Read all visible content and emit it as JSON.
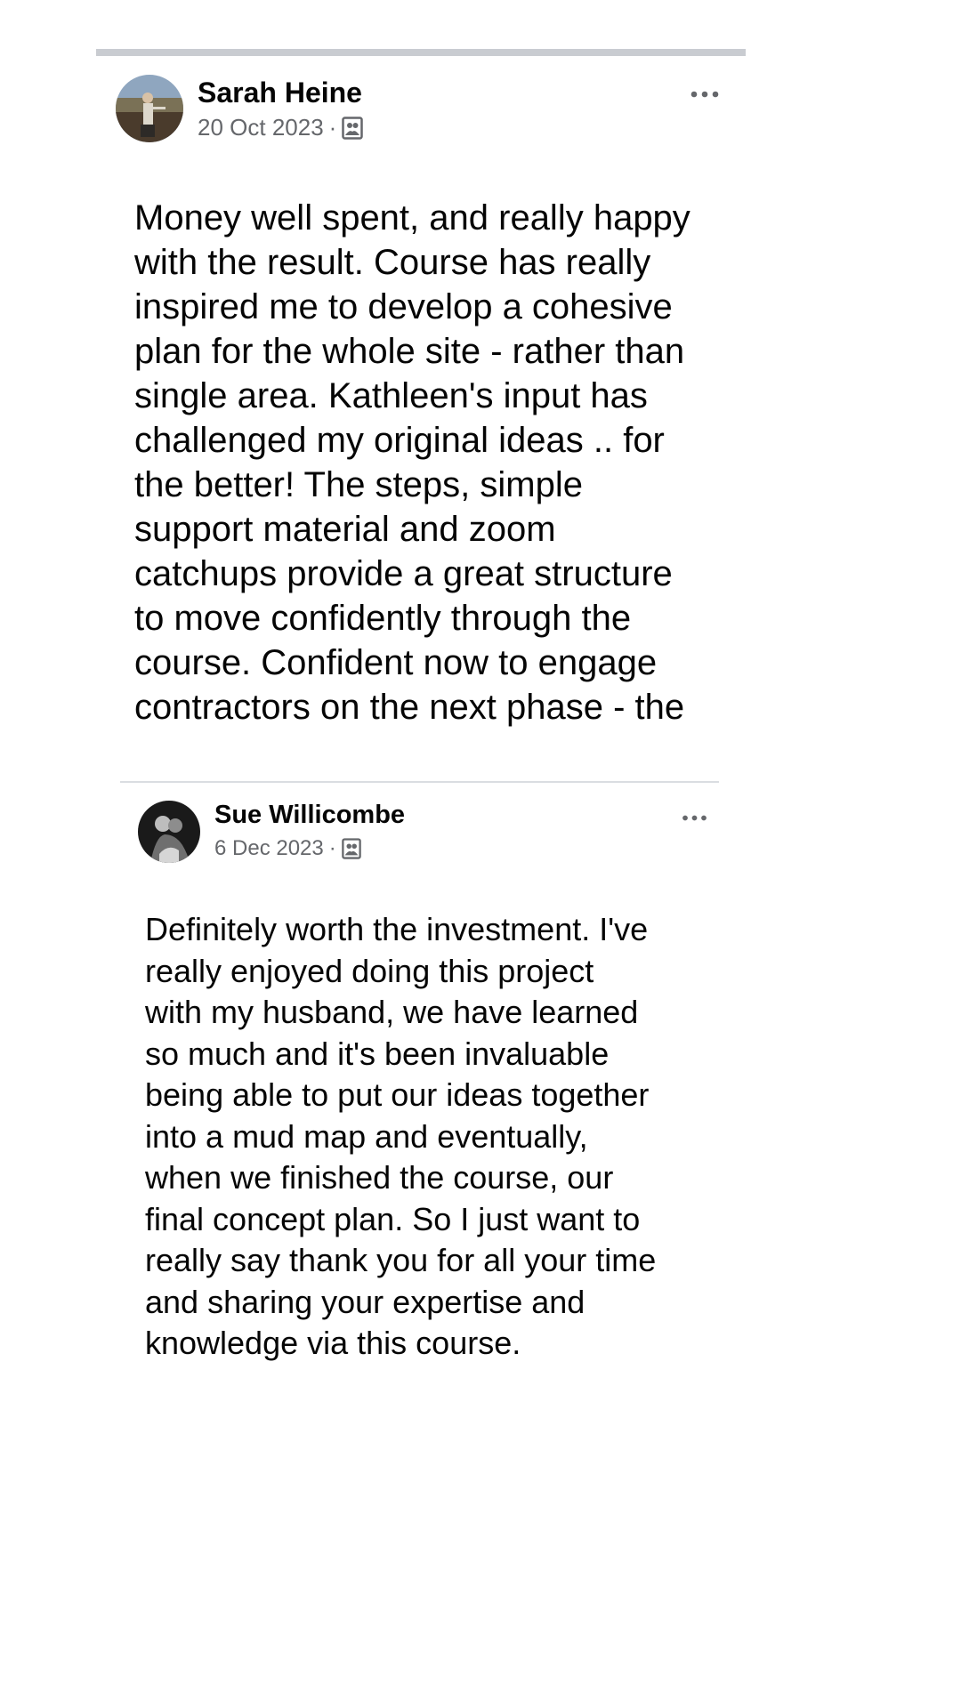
{
  "reviews": [
    {
      "author": "Sarah Heine",
      "date": "20 Oct 2023",
      "separator": "·",
      "audience_icon": "friends-audience-icon",
      "more_icon": "ellipsis-icon",
      "text": "Money well spent, and really happy\nwith the result. Course has really\ninspired me to develop a cohesive\nplan for the whole site - rather than\nsingle area. Kathleen's input has\nchallenged my original ideas .. for\nthe better! The steps, simple\nsupport material and zoom\ncatchups provide a great structure\nto move confidently through the\ncourse. Confident now to engage\ncontractors on the next phase - the"
    },
    {
      "author": "Sue Willicombe",
      "date": "6 Dec 2023",
      "separator": "·",
      "audience_icon": "friends-audience-icon",
      "more_icon": "ellipsis-icon",
      "text": "Definitely worth the investment. I've\nreally enjoyed doing this project\nwith my husband, we have learned\nso much and it's been invaluable\nbeing able to put our ideas together\ninto a mud map and eventually,\nwhen we finished the course, our\nfinal concept plan. So I just want to\nreally say thank you for all your time\nand sharing your expertise and\nknowledge via this course."
    }
  ],
  "colors": {
    "text_primary": "#050505",
    "text_secondary": "#65676b",
    "divider": "#c9ccd1"
  }
}
